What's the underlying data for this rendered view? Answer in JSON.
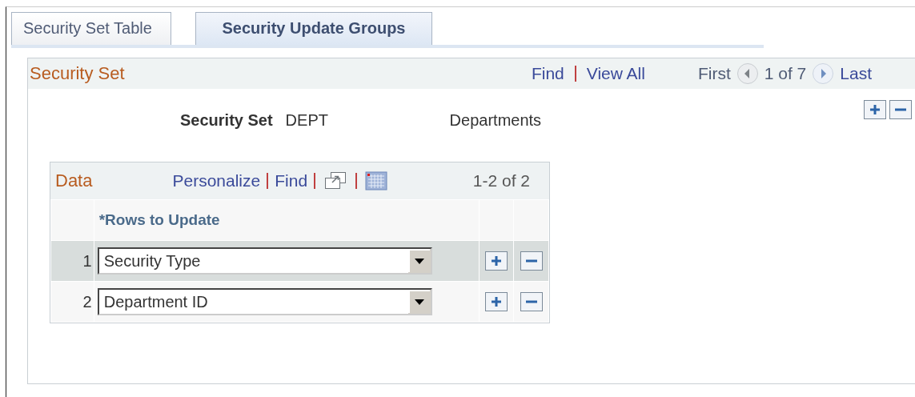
{
  "tabs": [
    {
      "label": "Security Set Table",
      "selected": false
    },
    {
      "label": "Security Update Groups",
      "selected": true
    }
  ],
  "security_set": {
    "title": "Security Set",
    "find": "Find",
    "view_all": "View All",
    "first": "First",
    "position": "1 of 7",
    "last": "Last",
    "field_label": "Security Set",
    "value": "DEPT",
    "description": "Departments",
    "data_grid": {
      "title": "Data",
      "personalize": "Personalize",
      "find": "Find",
      "count": "1-2 of 2",
      "columns": [
        "*Rows to Update"
      ],
      "rows": [
        {
          "number": "1",
          "value": "Security Type",
          "selected": true
        },
        {
          "number": "2",
          "value": "Department ID",
          "selected": false
        }
      ]
    }
  }
}
